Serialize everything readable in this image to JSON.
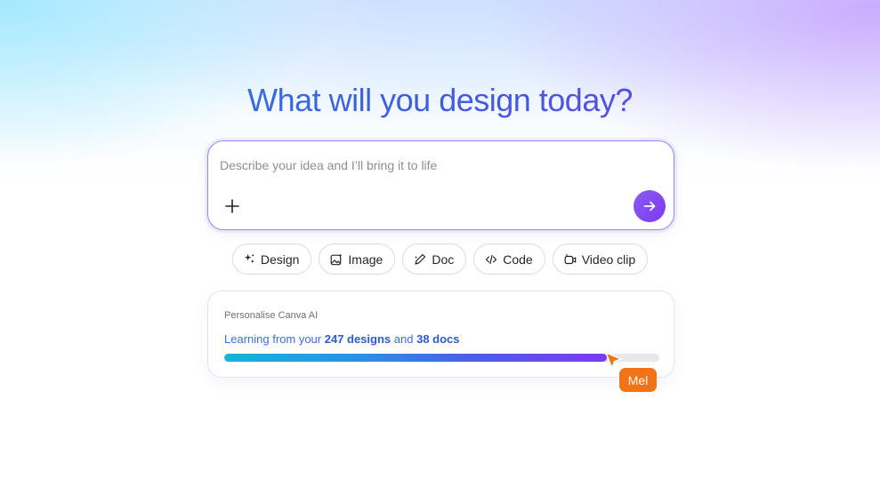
{
  "headline": "What will you design today?",
  "prompt": {
    "placeholder": "Describe your idea and I’ll bring it to life",
    "value": "",
    "add_icon": "plus-icon",
    "submit_icon": "arrow-right-icon"
  },
  "chips": [
    {
      "label": "Design",
      "icon": "sparkle-design-icon"
    },
    {
      "label": "Image",
      "icon": "image-sparkle-icon"
    },
    {
      "label": "Doc",
      "icon": "pen-sparkle-icon"
    },
    {
      "label": "Code",
      "icon": "code-icon"
    },
    {
      "label": "Video clip",
      "icon": "video-sparkle-icon"
    }
  ],
  "personalise": {
    "label": "Personalise Canva AI",
    "text_prefix": "Learning from your ",
    "designs": "247 designs",
    "text_middle": " and ",
    "docs": "38 docs",
    "progress": 0.88
  },
  "collaborator": {
    "name": "Mel",
    "color": "#f27216"
  },
  "colors": {
    "accent": "#8b5cf6",
    "headline_start": "#2f7fe6",
    "headline_end": "#6a3fe0"
  }
}
